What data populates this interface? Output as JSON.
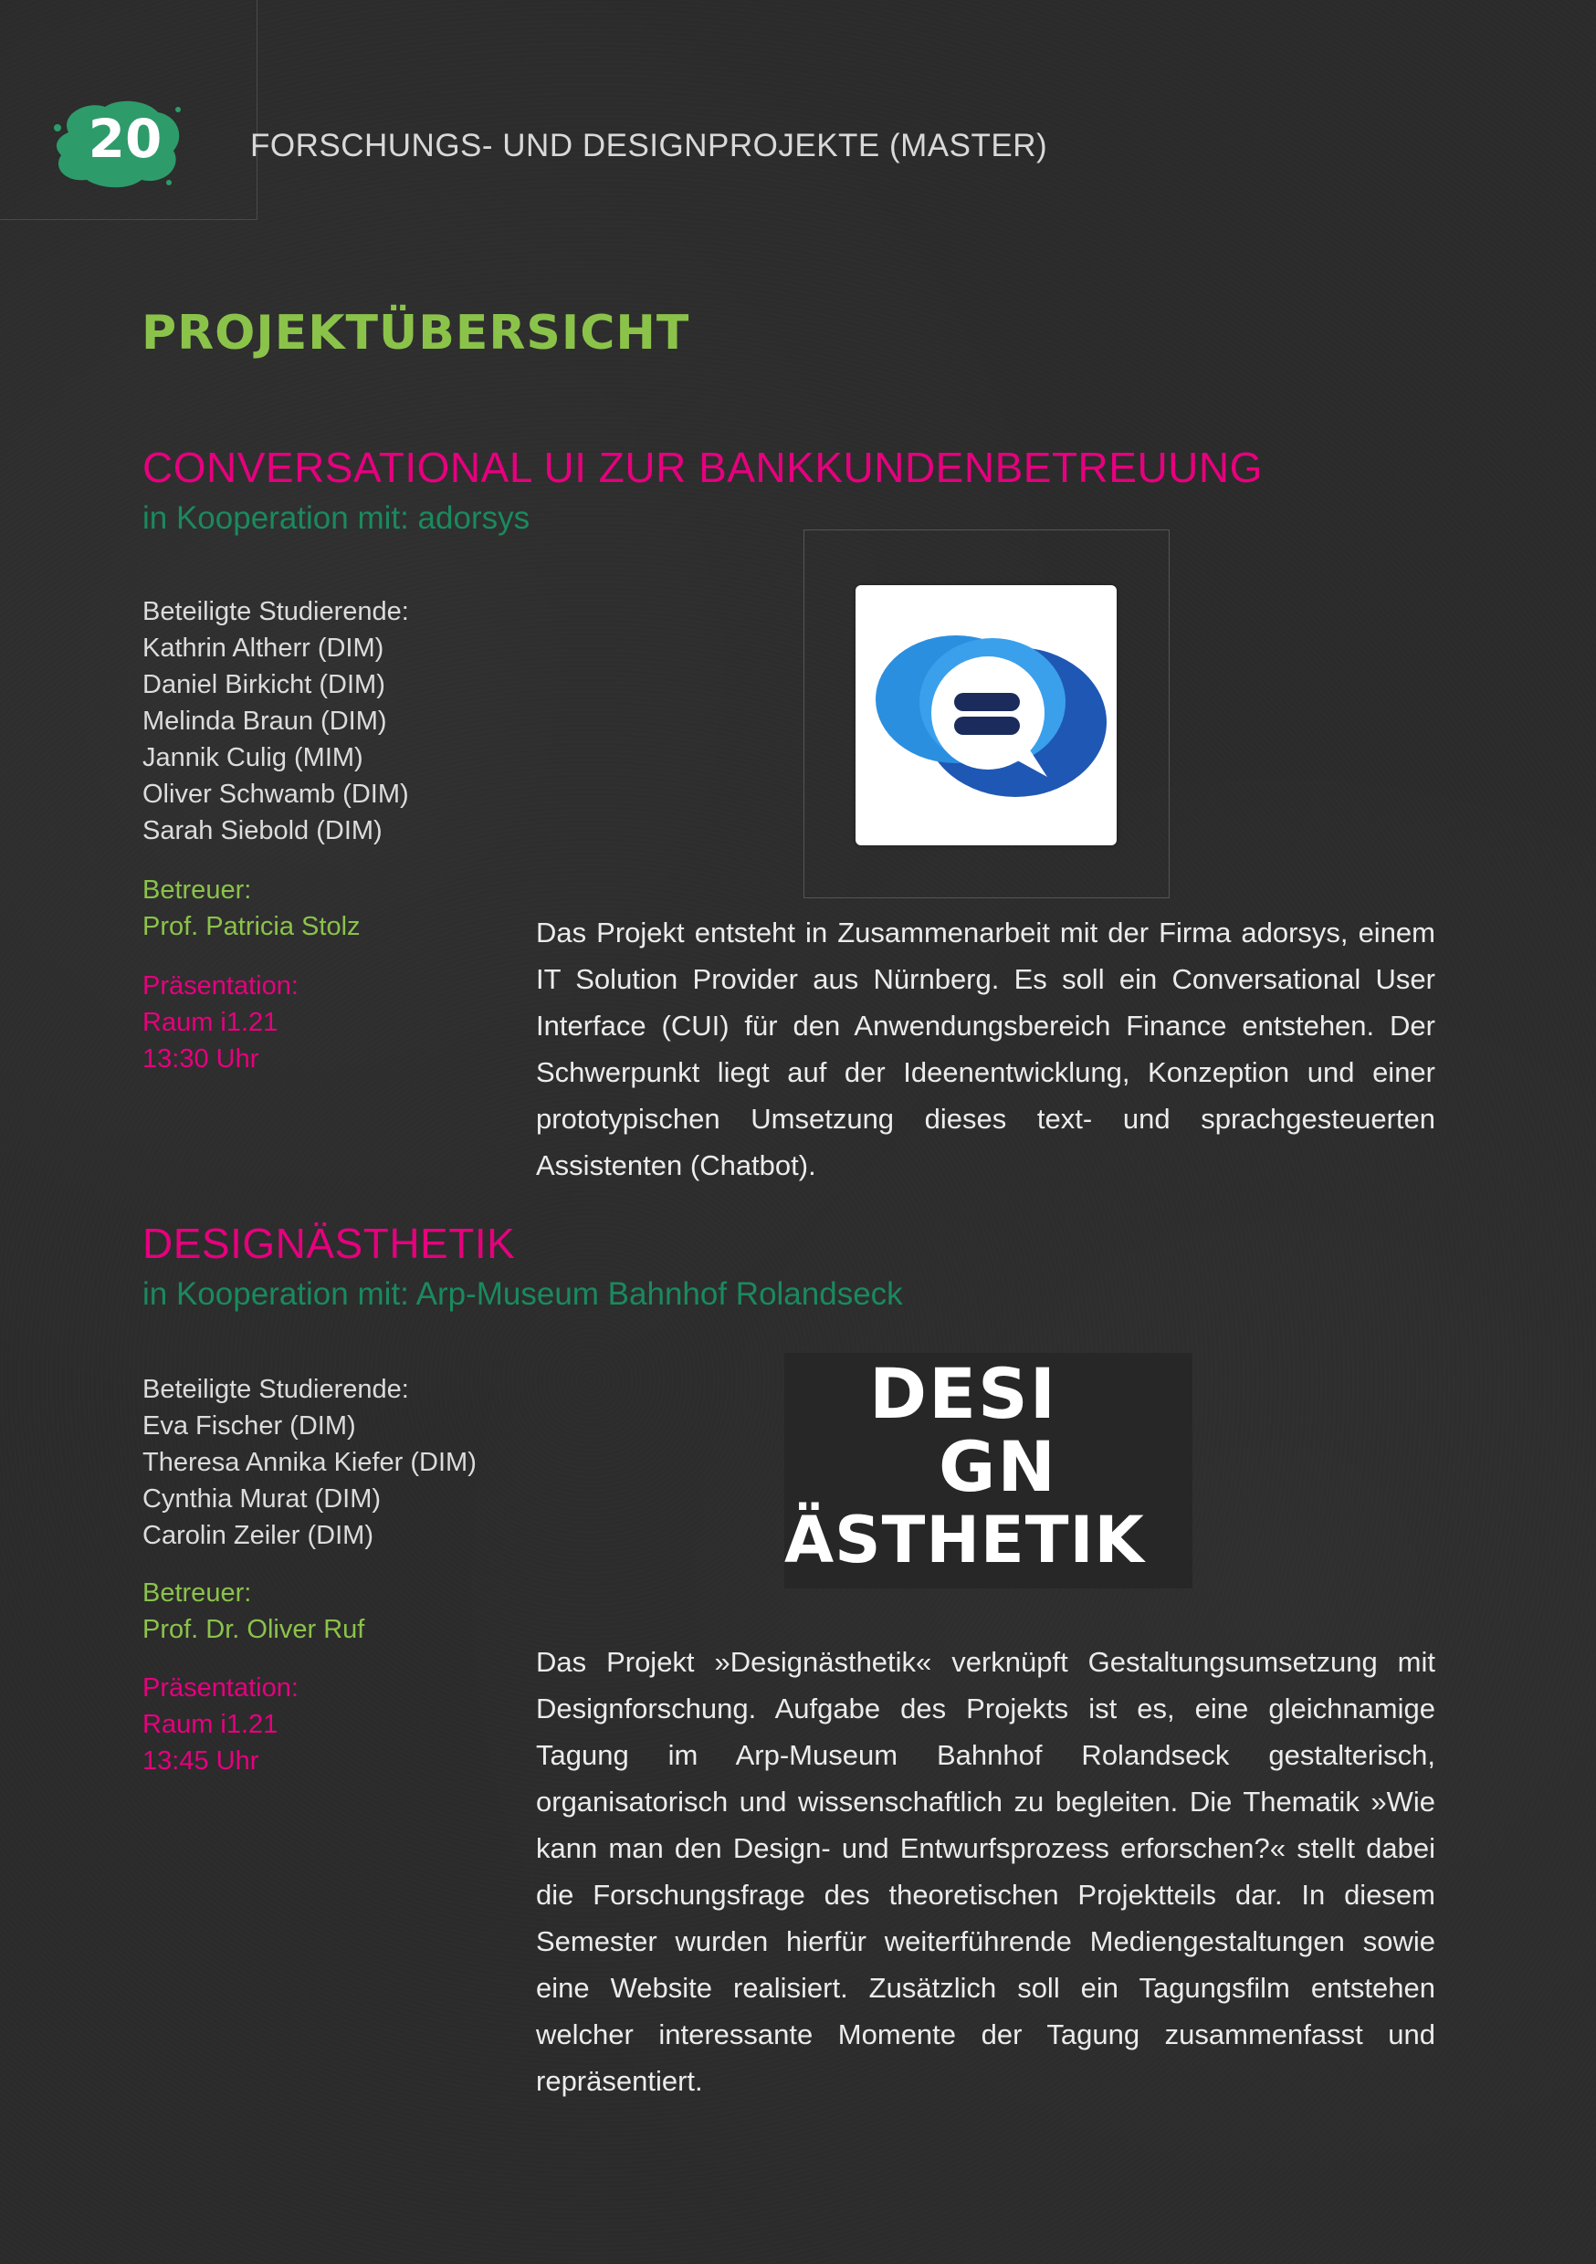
{
  "header": {
    "page_number": "20",
    "running_title": "FORSCHUNGS- UND DESIGNPROJEKTE (MASTER)"
  },
  "section_title": "PROJEKTÜBERSICHT",
  "colors": {
    "accent_magenta": "#e6007e",
    "accent_green": "#8bc34a",
    "coop_green": "#1a8a5e",
    "badge_green": "#2e9b6a",
    "background": "#2b2b2b"
  },
  "projects": [
    {
      "title": "CONVERSATIONAL UI ZUR BANKKUNDENBETREUUNG",
      "cooperation": "in Kooperation mit: adorsys",
      "students_label": "Beteiligte Studierende:",
      "students": [
        "Kathrin Altherr (DIM)",
        "Daniel Birkicht (DIM)",
        "Melinda Braun (DIM)",
        "Jannik Culig (MIM)",
        "Oliver Schwamb (DIM)",
        "Sarah Siebold (DIM)"
      ],
      "supervisor_label": "Betreuer:",
      "supervisor": "Prof. Patricia Stolz",
      "presentation_label": "Präsentation:",
      "room": "Raum i1.21",
      "time": "13:30 Uhr",
      "description": "Das Projekt entsteht in Zusammenarbeit mit der Firma adorsys, einem IT Solution Provider aus Nürnberg. Es soll ein Conversational User Interface (CUI) für den Anwendungsbereich Finance entstehen. Der Schwerpunkt liegt auf der Ideenentwicklung, Konzeption und einer prototypischen Umsetzung dieses text- und sprachgesteuerten Assistenten (Chatbot).",
      "logo_icon": "chat-bubble-logo-icon"
    },
    {
      "title": "DESIGNÄSTHETIK",
      "cooperation": "in Kooperation mit: Arp-Museum Bahnhof Rolandseck",
      "students_label": "Beteiligte Studierende:",
      "students": [
        "Eva Fischer (DIM)",
        "Theresa Annika Kiefer (DIM)",
        "Cynthia Murat (DIM)",
        "Carolin Zeiler (DIM)"
      ],
      "supervisor_label": "Betreuer:",
      "supervisor": "Prof. Dr. Oliver Ruf",
      "presentation_label": "Präsentation:",
      "room": "Raum i1.21",
      "time": "13:45 Uhr",
      "description": "Das Projekt »Designästhetik« verknüpft Gestaltungsumsetzung mit Designforschung. Aufgabe des Projekts ist es, eine gleichnamige Tagung im Arp-Museum Bahnhof Rolandseck gestalterisch, organisatorisch und wissenschaftlich zu begleiten. Die Thematik »Wie kann man den Design- und Entwurfsprozess erforschen?« stellt dabei die Forschungsfrage des theoretischen Projektteils dar. In diesem Semester wurden hierfür weiterführende Mediengestaltungen sowie eine Website realisiert. Zusätzlich soll ein Tagungsfilm entstehen welcher interessante Momente der Tagung zusammenfasst und repräsentiert.",
      "logo_lines": [
        "DESI",
        "GN",
        "ÄSTHETIK"
      ]
    }
  ]
}
